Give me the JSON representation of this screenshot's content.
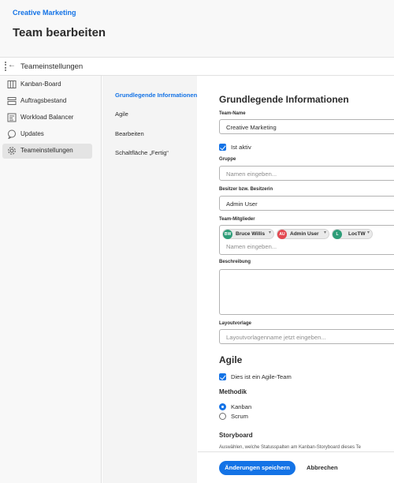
{
  "header": {
    "breadcrumb": "Creative Marketing",
    "title": "Team bearbeiten"
  },
  "subbar": {
    "title": "Teameinstellungen"
  },
  "leftnav": {
    "items": [
      {
        "label": "Kanban-Board",
        "icon": "board-icon"
      },
      {
        "label": "Auftragsbestand",
        "icon": "backlog-icon"
      },
      {
        "label": "Workload Balancer",
        "icon": "workload-icon"
      },
      {
        "label": "Updates",
        "icon": "chat-icon"
      },
      {
        "label": "Teameinstellungen",
        "icon": "gear-icon",
        "active": true
      }
    ]
  },
  "midnav": {
    "items": [
      {
        "label": "Grundlegende Informationen",
        "active": true
      },
      {
        "label": "Agile"
      },
      {
        "label": "Bearbeiten"
      },
      {
        "label": "Schaltfläche „Fertig“"
      }
    ]
  },
  "form": {
    "section_basic": "Grundlegende Informationen",
    "team_name_label": "Team-Name",
    "team_name_value": "Creative Marketing",
    "active_label": "Ist aktiv",
    "group_label": "Gruppe",
    "group_placeholder": "Namen eingeben...",
    "owner_label": "Besitzer bzw. Besitzerin",
    "owner_value": "Admin User",
    "members_label": "Team-Mitglieder",
    "members": [
      {
        "initials": "BW",
        "name": "Bruce Willis",
        "color": "#2d9d78"
      },
      {
        "initials": "AU",
        "name": "Admin User",
        "color": "#e34850"
      },
      {
        "initials": "L",
        "name": "LocTW",
        "color": "#2d9d78"
      }
    ],
    "members_placeholder": "Namen eingeben...",
    "description_label": "Beschreibung",
    "layout_label": "Layoutvorlage",
    "layout_placeholder": "Layoutvorlagenname jetzt eingeben...",
    "section_agile": "Agile",
    "agile_team_label": "Dies ist ein Agile-Team",
    "methodology_label": "Methodik",
    "method_options": [
      "Kanban",
      "Scrum"
    ],
    "method_selected": "Kanban",
    "storyboard_label": "Storyboard",
    "storyboard_desc": "Auswählen, welche Statusspalten am Kanban-Storyboard dieses Te"
  },
  "footer": {
    "save_label": "Änderungen speichern",
    "cancel_label": "Abbrechen"
  },
  "colors": {
    "accent": "#1473e6"
  }
}
